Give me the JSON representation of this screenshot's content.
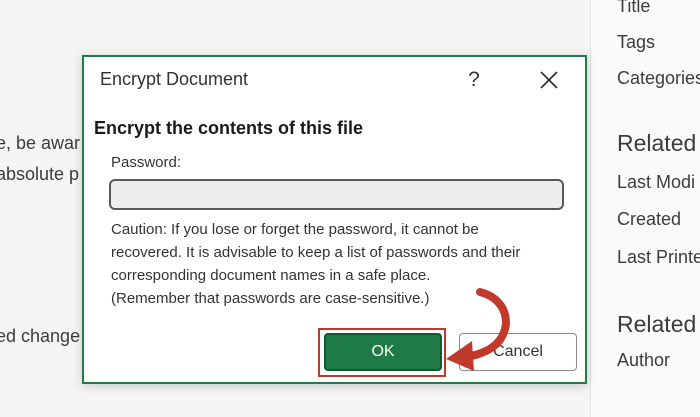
{
  "background": {
    "left_fragments": [
      "e, be awar",
      "absolute p",
      "ed change"
    ],
    "right_panel": {
      "props": [
        "Title",
        "Tags",
        "Categories"
      ],
      "related_dates_heading": "Related",
      "date_items": [
        "Last Modi",
        "Created",
        "Last Printe"
      ],
      "related_people_heading": "Related",
      "people_items": [
        "Author"
      ]
    }
  },
  "dialog": {
    "title": "Encrypt Document",
    "help_label": "?",
    "heading": "Encrypt the contents of this file",
    "password_label": "Password:",
    "password_value": "",
    "caution_lines": [
      "Caution: If you lose or forget the password, it cannot be",
      "recovered. It is advisable to keep a list of passwords and their",
      "corresponding document names in a safe place.",
      "(Remember that passwords are case-sensitive.)"
    ],
    "ok_label": "OK",
    "cancel_label": "Cancel"
  },
  "colors": {
    "accent_green": "#1f7a45",
    "highlight_red": "#c0392b",
    "dialog_border": "#1e7d4a"
  },
  "icons": [
    "close-icon",
    "help-icon",
    "pointer-arrow-icon"
  ]
}
